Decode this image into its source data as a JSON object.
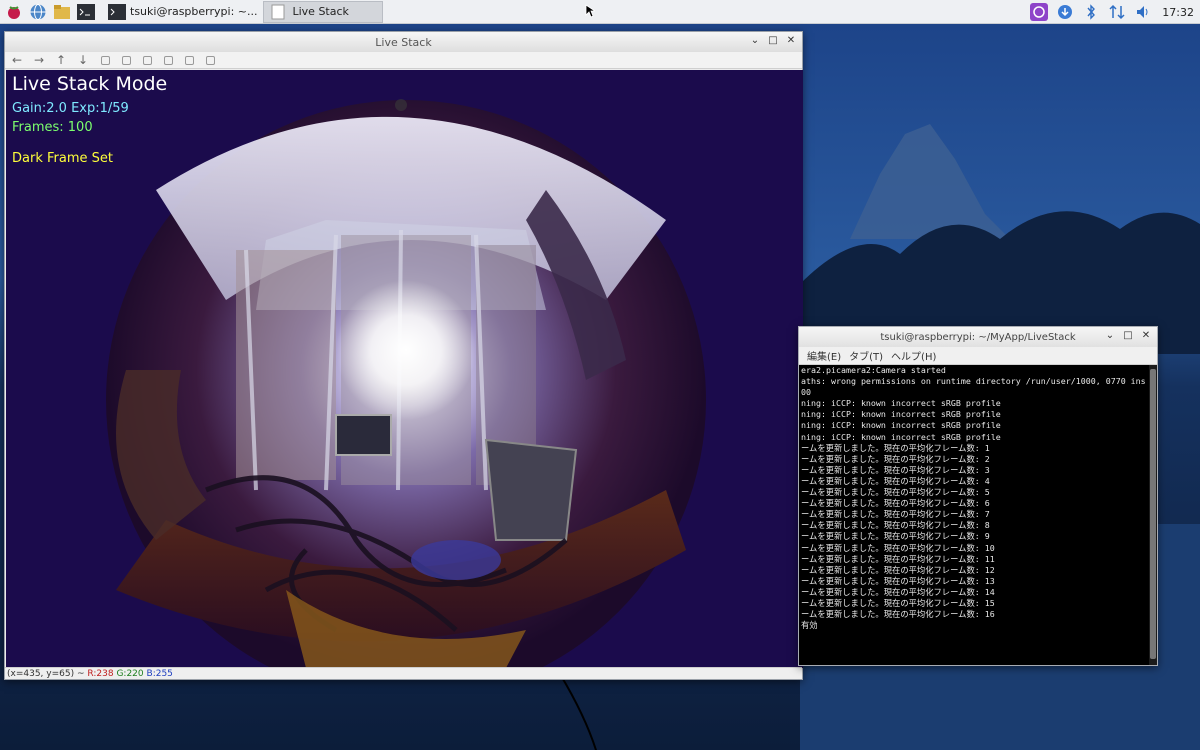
{
  "taskbar": {
    "tasks": [
      {
        "label": "tsuki@raspberrypi: ~..."
      },
      {
        "label": "Live Stack"
      }
    ],
    "clock": "17:32"
  },
  "livestack": {
    "title": "Live Stack",
    "overlay": {
      "title": "Live Stack Mode",
      "gain": "Gain:2.0  Exp:1/59",
      "frames": "Frames: 100",
      "dark": "Dark Frame Set"
    },
    "status": {
      "coords": "(x=435, y=65) ~",
      "r": "R:238",
      "g": "G:220",
      "b": "B:255"
    }
  },
  "terminal": {
    "title": "tsuki@raspberrypi: ~/MyApp/LiveStack",
    "menu": [
      "編集(E)",
      "タブ(T)",
      "ヘルプ(H)"
    ],
    "lines": [
      "era2.picamera2:Camera started",
      "aths: wrong permissions on runtime directory /run/user/1000, 0770 ins",
      "00",
      "ning: iCCP: known incorrect sRGB profile",
      "ning: iCCP: known incorrect sRGB profile",
      "ning: iCCP: known incorrect sRGB profile",
      "ning: iCCP: known incorrect sRGB profile",
      "ームを更新しました。現在の平均化フレーム数: 1",
      "ームを更新しました。現在の平均化フレーム数: 2",
      "ームを更新しました。現在の平均化フレーム数: 3",
      "ームを更新しました。現在の平均化フレーム数: 4",
      "ームを更新しました。現在の平均化フレーム数: 5",
      "ームを更新しました。現在の平均化フレーム数: 6",
      "ームを更新しました。現在の平均化フレーム数: 7",
      "ームを更新しました。現在の平均化フレーム数: 8",
      "ームを更新しました。現在の平均化フレーム数: 9",
      "ームを更新しました。現在の平均化フレーム数: 10",
      "ームを更新しました。現在の平均化フレーム数: 11",
      "ームを更新しました。現在の平均化フレーム数: 12",
      "ームを更新しました。現在の平均化フレーム数: 13",
      "ームを更新しました。現在の平均化フレーム数: 14",
      "ームを更新しました。現在の平均化フレーム数: 15",
      "ームを更新しました。現在の平均化フレーム数: 16",
      "有効"
    ]
  },
  "colors": {
    "overlay_title": "#ffffff",
    "overlay_gain": "#7fe9ff",
    "overlay_frames": "#7cff6e",
    "overlay_dark": "#ffff3a",
    "taskbar_bg": "#eef0f3",
    "terminal_bg": "#000000"
  }
}
